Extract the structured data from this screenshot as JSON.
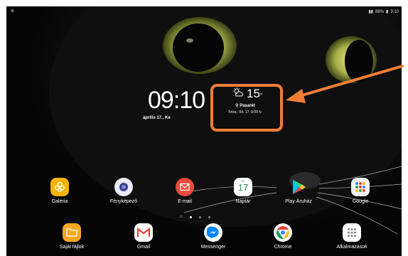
{
  "clock": {
    "time": "09:10",
    "date": "április 17., Ke"
  },
  "weather": {
    "temperature": "15",
    "degree": "°",
    "location": "Pasarét",
    "updated": "Friss.: 04. 17. 9:09"
  },
  "status": {
    "battery": "88%",
    "time": "9:10"
  },
  "apps_row1": [
    {
      "label": "Galéria",
      "icon": "flower-icon",
      "color": "#f5b400"
    },
    {
      "label": "Fényképező",
      "icon": "camera-icon",
      "color": "#eaeaf5"
    },
    {
      "label": "E-mail",
      "icon": "mail-icon",
      "color": "#e94b3c"
    },
    {
      "label": "Naptár",
      "icon": "calendar-icon",
      "color": "#ffffff",
      "day": "17",
      "weekday": "KE"
    },
    {
      "label": "Play Áruház",
      "icon": "play-store-icon",
      "color": "#ffffff"
    },
    {
      "label": "Google",
      "icon": "google-folder-icon",
      "color": "#f2f2f2"
    }
  ],
  "apps_row2": [
    {
      "label": "Saját fájlok",
      "icon": "folder-icon",
      "color": "#f9a825"
    },
    {
      "label": "Gmail",
      "icon": "gmail-icon",
      "color": "#ffffff"
    },
    {
      "label": "Messenger",
      "icon": "messenger-icon",
      "color": "#ffffff"
    },
    {
      "label": "Chrome",
      "icon": "chrome-icon",
      "color": "#ffffff"
    },
    {
      "label": "Alkalmazások",
      "icon": "apps-grid-icon",
      "color": "#ffffff"
    }
  ],
  "colors": {
    "highlight": "#ef7e35"
  }
}
